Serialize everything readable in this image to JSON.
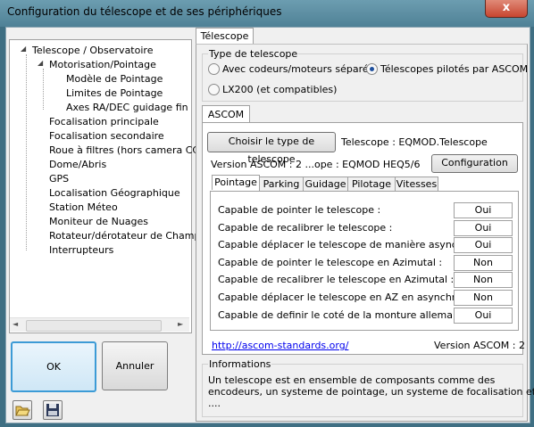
{
  "window": {
    "title": "Configuration du télescope et de ses périphériques",
    "close_glyph": "x"
  },
  "tree": {
    "items": [
      {
        "label": "Telescope / Observatoire",
        "expander": "◢"
      },
      {
        "label": "Motorisation/Pointage",
        "expander": "◢"
      },
      {
        "label": "Modèle de Pointage"
      },
      {
        "label": "Limites de Pointage"
      },
      {
        "label": "Axes RA/DEC guidage fin"
      },
      {
        "label": "Focalisation principale"
      },
      {
        "label": "Focalisation secondaire"
      },
      {
        "label": "Roue à filtres (hors camera CCD)"
      },
      {
        "label": "Dome/Abris"
      },
      {
        "label": "GPS"
      },
      {
        "label": "Localisation Géographique"
      },
      {
        "label": "Station Méteo"
      },
      {
        "label": "Moniteur de Nuages"
      },
      {
        "label": "Rotateur/dérotateur de Champ"
      },
      {
        "label": "Interrupteurs"
      }
    ],
    "scroll_left": "◄",
    "scroll_right": "►"
  },
  "buttons": {
    "ok": "OK",
    "cancel": "Annuler"
  },
  "main_tab": "Télescope",
  "type_group": {
    "legend": "Type de telescope",
    "option1": "Avec codeurs/moteurs séparés",
    "option2": "Télescopes pilotés par ASCOM",
    "option3": "LX200 (et compatibles)",
    "selected": "option2"
  },
  "ascom": {
    "tab": "ASCOM",
    "choose_button": "Choisir le type de telescope",
    "telescope_label": "Telescope :  EQMOD.Telescope",
    "version_label": "Version ASCOM : 2 ...ope : EQMOD HEQ5/6",
    "config_button": "Configuration",
    "subtabs": [
      "Pointage",
      "Parking",
      "Guidage",
      "Pilotage",
      "Vitesses"
    ],
    "capabilities": [
      {
        "label": "Capable de pointer le telescope :",
        "value": "Oui"
      },
      {
        "label": "Capable de recalibrer le telescope :",
        "value": "Oui"
      },
      {
        "label": "Capable déplacer le telescope de manière asynchrone :",
        "value": "Oui"
      },
      {
        "label": "Capable de pointer le telescope en Azimutal :",
        "value": "Non"
      },
      {
        "label": "Capable de recalibrer le telescope en Azimutal :",
        "value": "Non"
      },
      {
        "label": "Capable déplacer le telescope en AZ en asynchrone :",
        "value": "Non"
      },
      {
        "label": "Capable de definir le coté de la monture allemande :",
        "value": "Oui"
      }
    ],
    "link": "http://ascom-standards.org/",
    "version_short": "Version ASCOM : 2"
  },
  "info": {
    "legend": "Informations",
    "line1": "Un telescope est en ensemble de composants comme des",
    "line2": "encodeurs, un systeme de pointage, un systeme de focalisation etc",
    "line3": "...."
  },
  "icons": {
    "open": "folder-open-icon",
    "save": "floppy-disk-icon"
  }
}
